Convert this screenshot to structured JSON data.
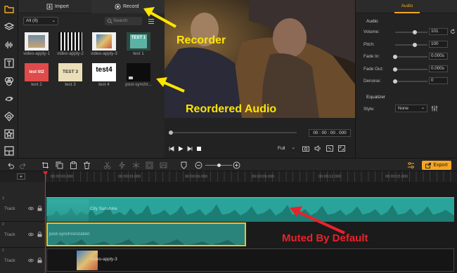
{
  "media": {
    "import_label": "Import",
    "record_label": "Record",
    "filter_label": "All (8)",
    "search_placeholder": "Search",
    "items": [
      {
        "label": "video-apply-1",
        "thumb_text": ""
      },
      {
        "label": "video-apply-2",
        "thumb_text": ""
      },
      {
        "label": "video-apply-3",
        "thumb_text": ""
      },
      {
        "label": "test 1",
        "thumb_text": "TEST 1"
      },
      {
        "label": "test 2",
        "thumb_text": "test tit2"
      },
      {
        "label": "test 3",
        "thumb_text": "TEST 3"
      },
      {
        "label": "test 4",
        "thumb_text": "test4"
      },
      {
        "label": "post-synchr...",
        "thumb_text": ""
      }
    ]
  },
  "preview": {
    "timecode": "00 : 00 : 00 . 000",
    "zoom": "Full"
  },
  "properties": {
    "tab": "Audio",
    "section": "Audio",
    "volume": {
      "label": "Volume:",
      "value": "101",
      "level": 0.6
    },
    "pitch": {
      "label": "Pitch:",
      "value": "100",
      "level": 0.6
    },
    "fade_in": {
      "label": "Fade In:",
      "value": "0.000s",
      "level": 0
    },
    "fade_out": {
      "label": "Fade Out:",
      "value": "0.000s",
      "level": 0
    },
    "denoise": {
      "label": "Denoise:",
      "value": "0",
      "level": 0
    },
    "equalizer": "Equalizer",
    "style_label": "Style:",
    "style_value": "None"
  },
  "toolbar": {
    "export_label": "Export"
  },
  "ruler": [
    "00:00:00.000",
    "00:00:03.000",
    "00:00:06.000",
    "00:00:09.000",
    "00:00:12.000",
    "00:00:15.000"
  ],
  "tracks": [
    {
      "num": "3",
      "name": "Track",
      "clip": "City Sunshine"
    },
    {
      "num": "2",
      "name": "Track",
      "clip": "post-synchronization"
    },
    {
      "num": "1",
      "name": "Track",
      "clip": "video-apply-3"
    }
  ],
  "annotations": {
    "recorder": "Recorder",
    "reordered": "Reordered Audio",
    "muted": "Muted By Default"
  },
  "colors": {
    "accent": "#f5a623",
    "annotation_yellow": "#ffe500",
    "annotation_red": "#e8222b",
    "track_teal": "#2aa39a"
  }
}
